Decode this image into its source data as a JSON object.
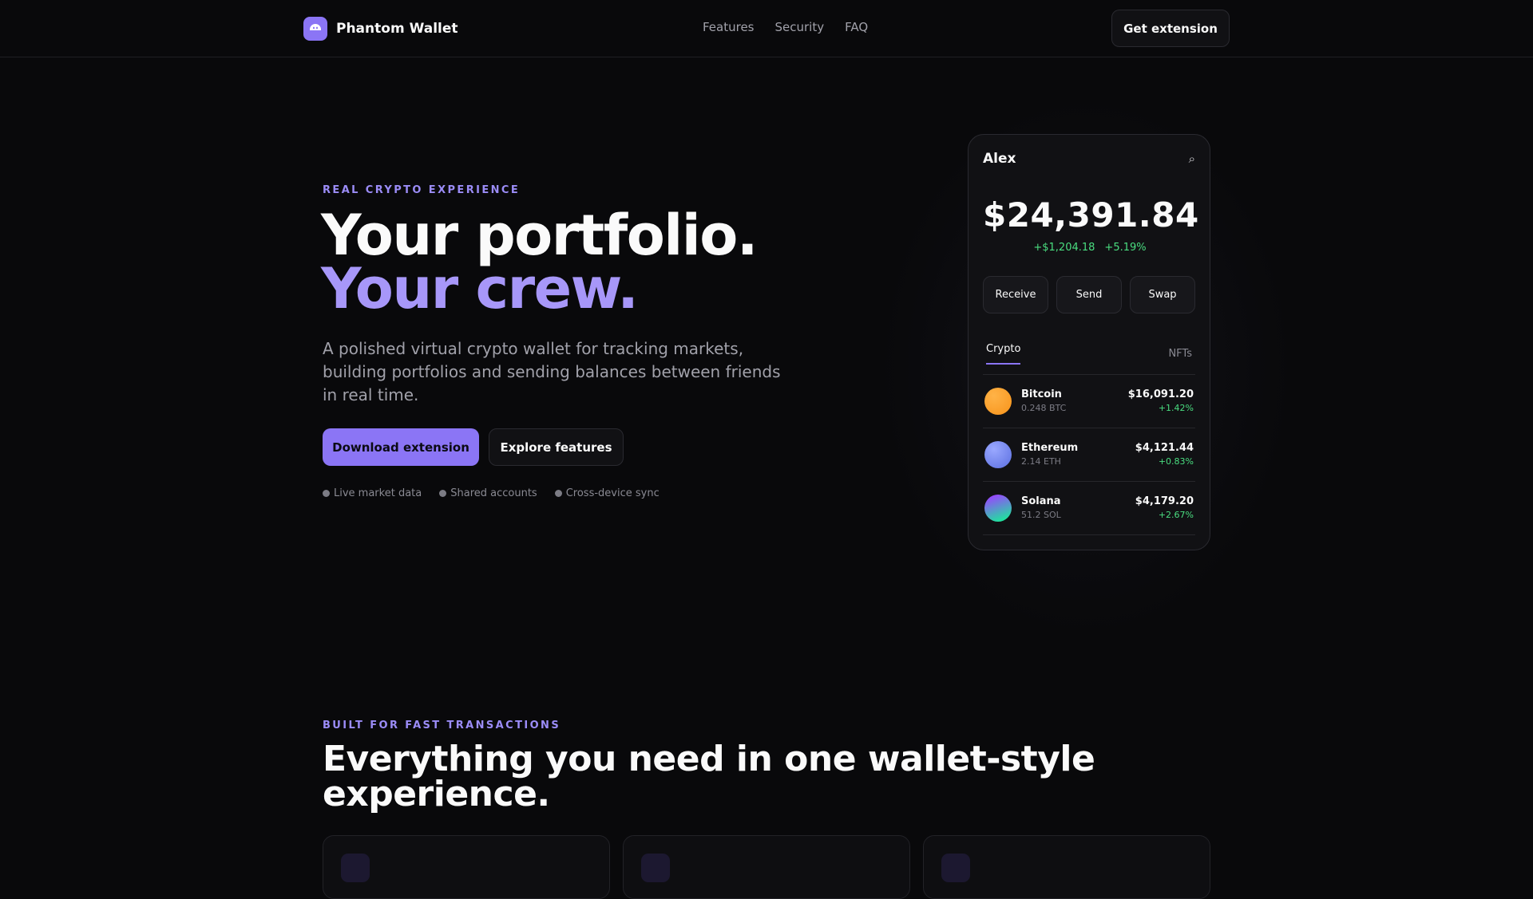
{
  "header": {
    "brand": "Phantom Wallet",
    "nav": [
      "Features",
      "Security",
      "FAQ"
    ],
    "cta": "Get extension"
  },
  "hero": {
    "eyebrow": "REAL CRYPTO EXPERIENCE",
    "title_line1": "Your portfolio.",
    "title_line2": "Your crew.",
    "description": "A polished virtual crypto wallet for tracking markets, building portfolios and sending balances between friends in real time.",
    "primary_button": "Download extension",
    "secondary_button": "Explore features",
    "perks": [
      "Live market data",
      "Shared accounts",
      "Cross-device sync"
    ]
  },
  "wallet": {
    "user": "Alex",
    "balance": "$24,391.84",
    "change_amount": "+$1,204.18",
    "change_percent": "+5.19%",
    "actions": [
      "Receive",
      "Send",
      "Swap"
    ],
    "tabs": [
      "Crypto",
      "NFTs"
    ],
    "assets": [
      {
        "name": "Bitcoin",
        "amount": "0.248 BTC",
        "value": "$16,091.20",
        "change": "+1.42%"
      },
      {
        "name": "Ethereum",
        "amount": "2.14 ETH",
        "value": "$4,121.44",
        "change": "+0.83%"
      },
      {
        "name": "Solana",
        "amount": "51.2 SOL",
        "value": "$4,179.20",
        "change": "+2.67%"
      }
    ]
  },
  "features": {
    "eyebrow": "BUILT FOR FAST TRANSACTIONS",
    "title": "Everything you need in one wallet-style experience."
  },
  "colors": {
    "accent": "#8b75f5",
    "accent_text": "#a797f9",
    "positive": "#4ade80",
    "background": "#09090b",
    "bitcoin": "#f7931a",
    "ethereum": "#6f8cf0",
    "solana": "#9945ff"
  }
}
